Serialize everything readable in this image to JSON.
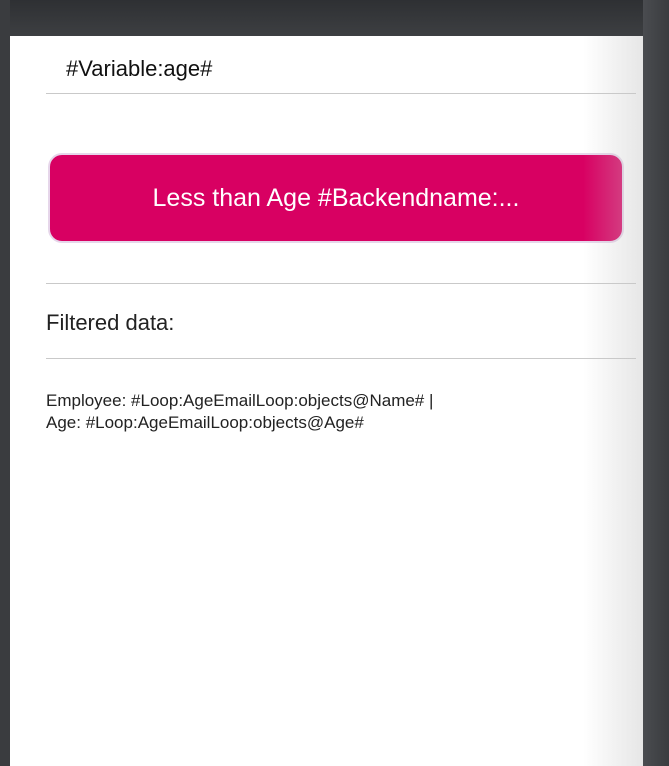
{
  "form": {
    "variable_value": "#Variable:age#",
    "filter_button_label": "Less than Age #Backendname:...",
    "filtered_label": "Filtered data:",
    "result_line_1": "Employee: #Loop:AgeEmailLoop:objects@Name# |",
    "result_line_2": "Age: #Loop:AgeEmailLoop:objects@Age#"
  },
  "colors": {
    "accent": "#d80062",
    "frame": "#3a3c3f",
    "background": "#ffffff"
  }
}
